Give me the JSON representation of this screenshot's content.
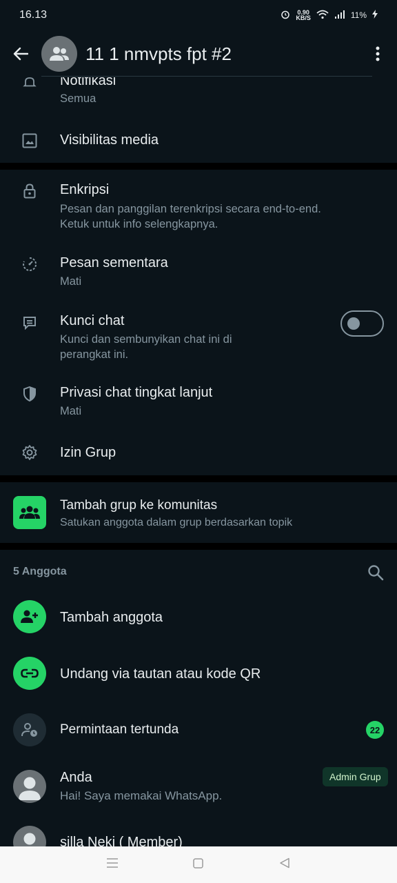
{
  "status_bar": {
    "time": "16.13",
    "net_speed_value": "0.90",
    "net_speed_unit": "KB/S",
    "battery": "11%"
  },
  "header": {
    "title": "11 1 nmvpts fpt #2"
  },
  "settings": {
    "notifications": {
      "label": "Notifikasi",
      "value": "Semua"
    },
    "media_visibility": {
      "label": "Visibilitas media"
    },
    "encryption": {
      "label": "Enkripsi",
      "description_line1": "Pesan dan panggilan terenkripsi secara end-to-end.",
      "description_line2": "Ketuk untuk info selengkapnya."
    },
    "disappearing": {
      "label": "Pesan sementara",
      "value": "Mati"
    },
    "chat_lock": {
      "label": "Kunci chat",
      "description_line1": "Kunci dan sembunyikan chat ini di",
      "description_line2": "perangkat ini.",
      "enabled": false
    },
    "advanced_privacy": {
      "label": "Privasi chat tingkat lanjut",
      "value": "Mati"
    },
    "group_permissions": {
      "label": "Izin Grup"
    }
  },
  "community": {
    "label": "Tambah grup ke komunitas",
    "description": "Satukan anggota dalam grup berdasarkan topik"
  },
  "members": {
    "header": "5 Anggota",
    "add_member": "Tambah anggota",
    "invite_link": "Undang via tautan atau kode QR",
    "pending_requests": "Permintaan tertunda",
    "pending_count": "22",
    "list": [
      {
        "name": "Anda",
        "status": "Hai! Saya memakai WhatsApp.",
        "badge": "Admin Grup"
      },
      {
        "name": "silla Neki ( Member)"
      }
    ]
  },
  "colors": {
    "background": "#0b141a",
    "accent": "#25d366",
    "secondary_text": "#8696a0"
  }
}
